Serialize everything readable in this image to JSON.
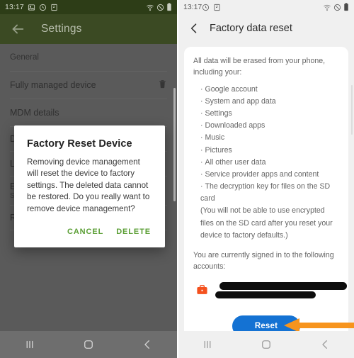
{
  "left_screen": {
    "status_bar": {
      "time": "13:17",
      "left_icons": [
        "image-icon",
        "clock-icon",
        "app-icon"
      ],
      "right_icons": [
        "wifi-icon",
        "do-not-disturb-icon",
        "battery-icon"
      ]
    },
    "app_bar": {
      "back_icon": "back-arrow-icon",
      "title": "Settings",
      "bar_color": "#3b4a23"
    },
    "list": {
      "section_general": "General",
      "item_managed_device": "Fully managed device",
      "item_managed_device_trailing_icon": "trash-icon",
      "item_mdm_details": "MDM details",
      "item_partial_d": "D",
      "item_partial_l": "L",
      "item_partial_e": "E",
      "item_partial_s": "S",
      "item_partial_r": "R"
    },
    "dialog": {
      "title": "Factory Reset Device",
      "message": "Removing device management will reset the device to factory settings. The deleted data cannot be restored. Do you really want to remove device management?",
      "cancel_label": "CANCEL",
      "delete_label": "DELETE",
      "action_color": "#5a9e34"
    },
    "nav_bar": {
      "recents": "recents-icon",
      "home": "home-icon",
      "back": "back-icon"
    }
  },
  "right_screen": {
    "status_bar": {
      "time": "13:17",
      "left_icons": [
        "clock-icon",
        "app-icon"
      ],
      "right_icons": [
        "wifi-icon",
        "do-not-disturb-icon",
        "battery-icon"
      ]
    },
    "app_bar": {
      "back_icon": "back-chevron-icon",
      "title": "Factory data reset"
    },
    "card": {
      "intro": "All data will be erased from your phone, including your:",
      "erase_items": [
        "Google account",
        "System and app data",
        "Settings",
        "Downloaded apps",
        "Music",
        "Pictures",
        "All other user data",
        "Service provider apps and content",
        "The decryption key for files on the SD card"
      ],
      "note": "(You will not be able to use encrypted files on the SD card after you reset your device to factory defaults.)",
      "accounts_label": "You are currently signed in to the following accounts:",
      "account_icon": "work-briefcase-icon",
      "account_redacted": true
    },
    "reset_button": {
      "label": "Reset",
      "color": "#1472d3"
    },
    "annotation": {
      "arrow_icon": "left-pointing-arrow-icon",
      "color": "#f7941d"
    },
    "nav_bar": {
      "recents": "recents-icon",
      "home": "home-icon",
      "back": "back-icon"
    }
  }
}
